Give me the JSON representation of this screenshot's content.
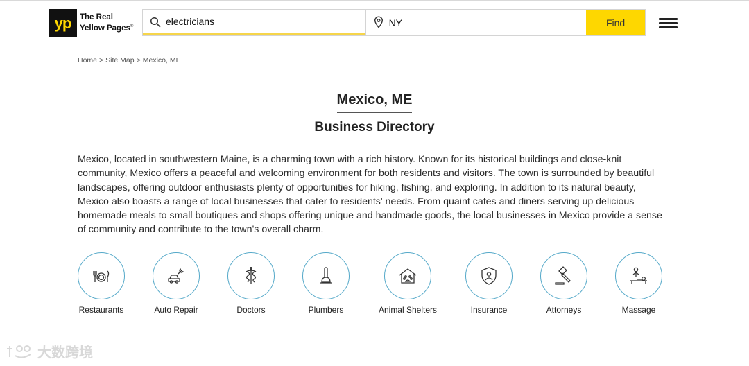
{
  "header": {
    "logo": {
      "mark": "yp",
      "line1": "The Real",
      "line2": "Yellow Pages",
      "reg": "®"
    },
    "search": {
      "what_value": "electricians",
      "where_value": "NY",
      "find_label": "Find"
    }
  },
  "breadcrumb": [
    {
      "label": "Home"
    },
    {
      "label": "Site Map"
    },
    {
      "label": "Mexico, ME"
    }
  ],
  "breadcrumb_sep": ">",
  "page": {
    "title": "Mexico, ME",
    "subtitle": "Business Directory",
    "description": "Mexico, located in southwestern Maine, is a charming town with a rich history. Known for its historical buildings and close-knit community, Mexico offers a peaceful and welcoming environment for both residents and visitors. The town is surrounded by beautiful landscapes, offering outdoor enthusiasts plenty of opportunities for hiking, fishing, and exploring. In addition to its natural beauty, Mexico also boasts a range of local businesses that cater to residents' needs. From quaint cafes and diners serving up delicious homemade meals to small boutiques and shops offering unique and handmade goods, the local businesses in Mexico provide a sense of community and contribute to the town's overall charm."
  },
  "categories": [
    {
      "label": "Restaurants",
      "icon": "restaurant-icon"
    },
    {
      "label": "Auto Repair",
      "icon": "auto-repair-icon"
    },
    {
      "label": "Doctors",
      "icon": "doctor-icon"
    },
    {
      "label": "Plumbers",
      "icon": "plunger-icon"
    },
    {
      "label": "Animal Shelters",
      "icon": "animal-shelter-icon"
    },
    {
      "label": "Insurance",
      "icon": "insurance-shield-icon"
    },
    {
      "label": "Attorneys",
      "icon": "gavel-icon"
    },
    {
      "label": "Massage",
      "icon": "massage-icon"
    }
  ],
  "watermark": {
    "text": "大数跨境"
  },
  "colors": {
    "brand_yellow": "#fed700",
    "icon_ring": "#55a9c9",
    "logo_bg": "#111111"
  }
}
